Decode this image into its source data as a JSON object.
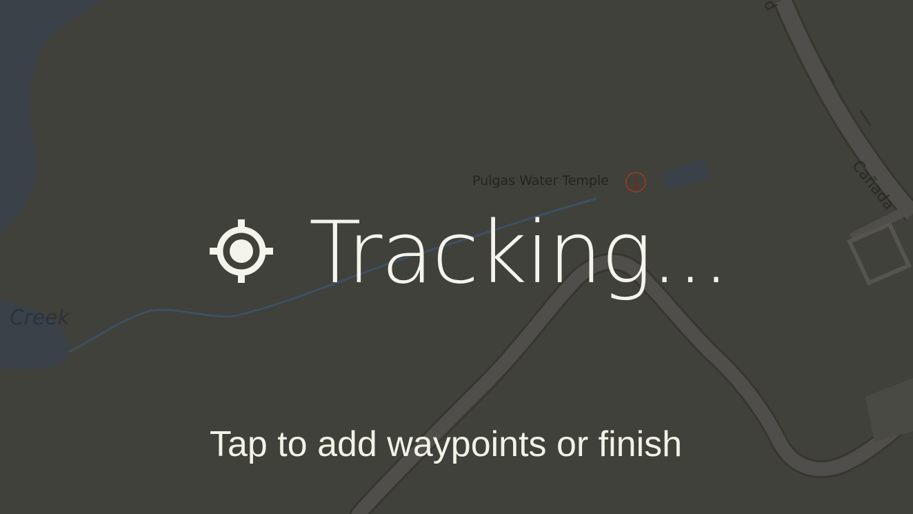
{
  "map": {
    "creek_label": "Creek",
    "poi_label": "Pulgas Water Temple",
    "poi_icon": "landmark-icon",
    "road_label_right": "Cañada",
    "road_label_top": "d",
    "colors": {
      "background": "#40413a",
      "water": "#3a4148",
      "road_fill": "#4f4e4a",
      "road_edge": "#37362f",
      "stream": "#3e5064",
      "poi_circle": "#8a3a2c"
    }
  },
  "status": {
    "icon": "gps-target-icon",
    "title": "Tracking...",
    "hint": "Tap to add waypoints or finish",
    "text_color": "#f4f4ec"
  }
}
